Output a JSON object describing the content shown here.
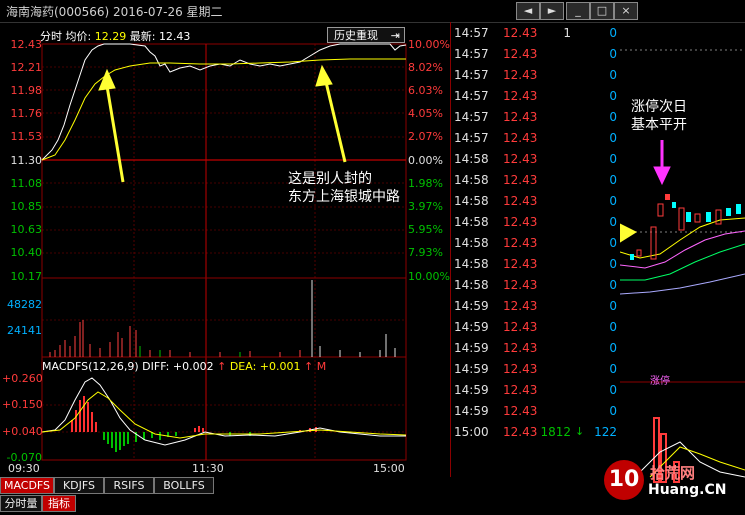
{
  "window": {
    "title": "海南海药(000566)  2016-07-26 星期二",
    "buttons": [
      "◄",
      "►",
      "_",
      "□",
      "×"
    ]
  },
  "chart_header": {
    "mode": "分时",
    "avg_label": "均价:",
    "avg_value": "12.29",
    "last_label": "最新:",
    "last_value": "12.43",
    "history_button": "历史重现"
  },
  "price_axis": {
    "left": [
      "12.43",
      "12.21",
      "11.98",
      "11.76",
      "11.53",
      "11.30",
      "11.08",
      "10.85",
      "10.63",
      "10.40",
      "10.17"
    ],
    "right": [
      "10.00%",
      "8.02%",
      "6.03%",
      "4.05%",
      "2.07%",
      "0.00%",
      "1.98%",
      "3.97%",
      "5.95%",
      "7.93%",
      "10.00%"
    ]
  },
  "volume_axis": [
    "48282",
    "24141"
  ],
  "macd": {
    "label": "MACDFS(12,26,9)",
    "diff": "DIFF: +0.002",
    "dea": "DEA: +0.001",
    "ma": "M",
    "axis": [
      "+0.260",
      "+0.150",
      "+0.040",
      "-0.070"
    ]
  },
  "time_axis": [
    "09:30",
    "11:30",
    "15:00"
  ],
  "tabs": [
    "MACDFS",
    "KDJFS",
    "RSIFS",
    "BOLLFS"
  ],
  "bottom_tabs": [
    "分时量",
    "指标"
  ],
  "annotations": {
    "left_text_1": "这是别人封的",
    "left_text_2": "东方上海银城中路",
    "right_text_1": "涨停次日",
    "right_text_2": "基本平开",
    "limit_tag": "涨停"
  },
  "watermark": {
    "logo": "10",
    "site": "拾荒网",
    "domain": "Huang.CN"
  },
  "ticks": [
    {
      "time": "14:57",
      "price": "12.43",
      "vol": "1",
      "mark": "",
      "num": "0"
    },
    {
      "time": "14:57",
      "price": "12.43",
      "vol": "",
      "mark": "",
      "num": "0"
    },
    {
      "time": "14:57",
      "price": "12.43",
      "vol": "",
      "mark": "",
      "num": "0"
    },
    {
      "time": "14:57",
      "price": "12.43",
      "vol": "",
      "mark": "",
      "num": "0"
    },
    {
      "time": "14:57",
      "price": "12.43",
      "vol": "",
      "mark": "",
      "num": "0"
    },
    {
      "time": "14:57",
      "price": "12.43",
      "vol": "",
      "mark": "",
      "num": "0"
    },
    {
      "time": "14:58",
      "price": "12.43",
      "vol": "",
      "mark": "",
      "num": "0"
    },
    {
      "time": "14:58",
      "price": "12.43",
      "vol": "",
      "mark": "",
      "num": "0"
    },
    {
      "time": "14:58",
      "price": "12.43",
      "vol": "",
      "mark": "",
      "num": "0"
    },
    {
      "time": "14:58",
      "price": "12.43",
      "vol": "",
      "mark": "",
      "num": "0"
    },
    {
      "time": "14:58",
      "price": "12.43",
      "vol": "",
      "mark": "",
      "num": "0"
    },
    {
      "time": "14:58",
      "price": "12.43",
      "vol": "",
      "mark": "",
      "num": "0"
    },
    {
      "time": "14:58",
      "price": "12.43",
      "vol": "",
      "mark": "",
      "num": "0"
    },
    {
      "time": "14:59",
      "price": "12.43",
      "vol": "",
      "mark": "",
      "num": "0"
    },
    {
      "time": "14:59",
      "price": "12.43",
      "vol": "",
      "mark": "",
      "num": "0"
    },
    {
      "time": "14:59",
      "price": "12.43",
      "vol": "",
      "mark": "",
      "num": "0"
    },
    {
      "time": "14:59",
      "price": "12.43",
      "vol": "",
      "mark": "",
      "num": "0"
    },
    {
      "time": "14:59",
      "price": "12.43",
      "vol": "",
      "mark": "",
      "num": "0"
    },
    {
      "time": "14:59",
      "price": "12.43",
      "vol": "",
      "mark": "",
      "num": "0"
    },
    {
      "time": "15:00",
      "price": "12.43",
      "vol": "1812",
      "mark": "↓",
      "num": "122"
    }
  ],
  "colors": {
    "up": "#ff3b3b",
    "down": "#00c000",
    "avg": "#ffff00",
    "price": "#ffffff",
    "grid": "#8b0000",
    "arrow": "#ffff33",
    "magenta": "#ff33ff"
  }
}
